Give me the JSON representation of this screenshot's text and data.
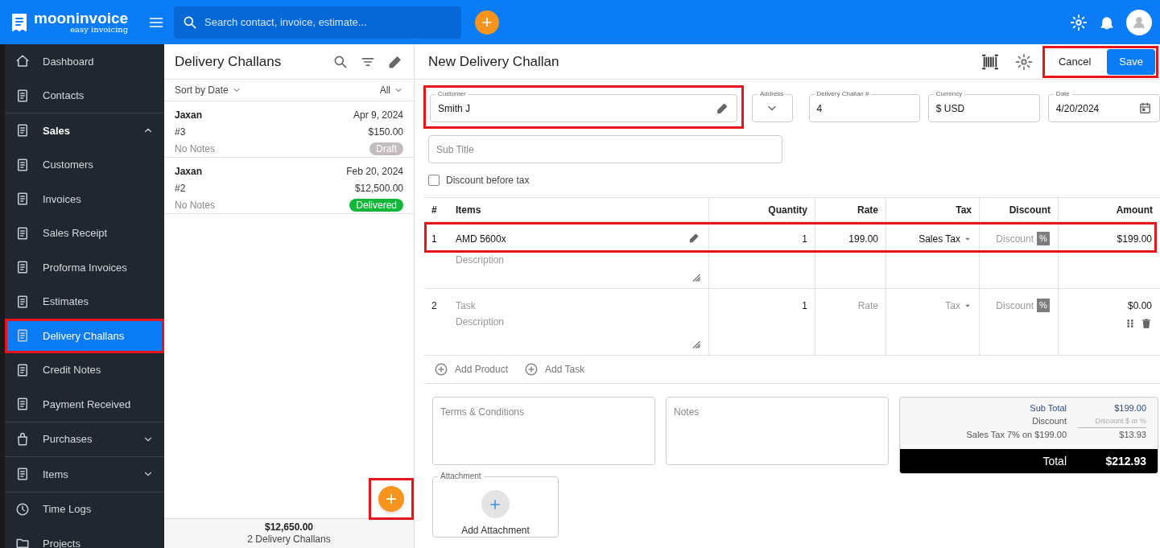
{
  "header": {
    "brand": "mooninvoice",
    "tagline": "easy invoicing",
    "search_placeholder": "Search contact, invoice, estimate...",
    "add_label": "+"
  },
  "sidebar": {
    "items": [
      {
        "label": "Dashboard",
        "selected": false,
        "highlighted": false
      },
      {
        "label": "Contacts",
        "selected": false,
        "highlighted": false
      },
      {
        "label": "Sales",
        "selected": false,
        "highlighted": false,
        "expanded": true,
        "children": [
          {
            "label": "Customers",
            "selected": false,
            "highlighted": false
          },
          {
            "label": "Invoices",
            "selected": false,
            "highlighted": false
          },
          {
            "label": "Sales Receipt",
            "selected": false,
            "highlighted": false
          },
          {
            "label": "Proforma Invoices",
            "selected": false,
            "highlighted": false
          },
          {
            "label": "Estimates",
            "selected": false,
            "highlighted": false
          },
          {
            "label": "Delivery Challans",
            "selected": true,
            "highlighted": true
          },
          {
            "label": "Credit Notes",
            "selected": false,
            "highlighted": false
          },
          {
            "label": "Payment Received",
            "selected": false,
            "highlighted": false
          }
        ]
      },
      {
        "label": "Purchases",
        "selected": false,
        "highlighted": false,
        "expanded": false
      },
      {
        "label": "Items",
        "selected": false,
        "highlighted": false,
        "expanded": false
      },
      {
        "label": "Time Logs",
        "selected": false,
        "highlighted": false
      },
      {
        "label": "Projects",
        "selected": false,
        "highlighted": false
      }
    ]
  },
  "list_panel": {
    "title": "Delivery Challans",
    "sort": "Sort by Date",
    "filter": "All",
    "challans": [
      {
        "customer": "Jaxan",
        "date": "Apr 9, 2024",
        "number": "#3",
        "amount": "$150.00",
        "notes": "No Notes",
        "status": "Draft",
        "color": "#c4bcbc"
      },
      {
        "customer": "Jaxan",
        "date": "Feb 20, 2024",
        "number": "#2",
        "amount": "$12,500.00",
        "notes": "No Notes",
        "status": "Delivered",
        "color": "#13b83a"
      }
    ],
    "fab": {
      "label": "+",
      "highlighted": true
    },
    "footer_total": "$12,650.00",
    "footer_count": "2 Delivery Challans"
  },
  "form": {
    "title": "New Delivery Challan",
    "cancel": "Cancel",
    "save": "Save",
    "actions_highlighted": true,
    "customer": {
      "label": "Customer",
      "value": "Smith J",
      "highlighted": true
    },
    "address": {
      "label": "Address"
    },
    "number": {
      "label": "Delivery Challan #",
      "value": "4"
    },
    "currency": {
      "label": "Currency",
      "value": "$ USD"
    },
    "date": {
      "label": "Date",
      "value": "4/20/2024"
    },
    "subtitle": {
      "placeholder": "Sub Title"
    },
    "discount_before_tax": {
      "label": "Discount before tax",
      "checked": false
    },
    "table": {
      "columns": [
        "#",
        "Items",
        "Quantity",
        "Rate",
        "Tax",
        "Discount",
        "Amount"
      ],
      "rows": [
        {
          "index": "1",
          "item": "AMD 5600x",
          "description_placeholder": "Description",
          "quantity": "1",
          "rate": "199.00",
          "tax": "Sales Tax",
          "discount_placeholder": "Discount",
          "discount_unit": "%",
          "amount": "$199.00",
          "highlighted": true
        },
        {
          "index": "2",
          "item_placeholder": "Task",
          "description_placeholder": "Description",
          "quantity": "1",
          "rate_placeholder": "Rate",
          "tax_placeholder": "Tax",
          "discount_placeholder": "Discount",
          "discount_unit": "%",
          "amount": "$0.00",
          "highlighted": false
        }
      ]
    },
    "add_product": "Add Product",
    "add_task": "Add Task",
    "terms_placeholder": "Terms & Conditions",
    "notes_placeholder": "Notes",
    "totals": {
      "subtotal_label": "Sub Total",
      "subtotal": "$199.00",
      "discount_label": "Discount",
      "discount_placeholder": "Discount $ or %",
      "tax_label": "Sales Tax 7% on $199.00",
      "tax": "$13.93",
      "total_label": "Total",
      "total": "$212.93"
    },
    "attachment": {
      "label": "Attachment",
      "button": "Add Attachment"
    }
  }
}
